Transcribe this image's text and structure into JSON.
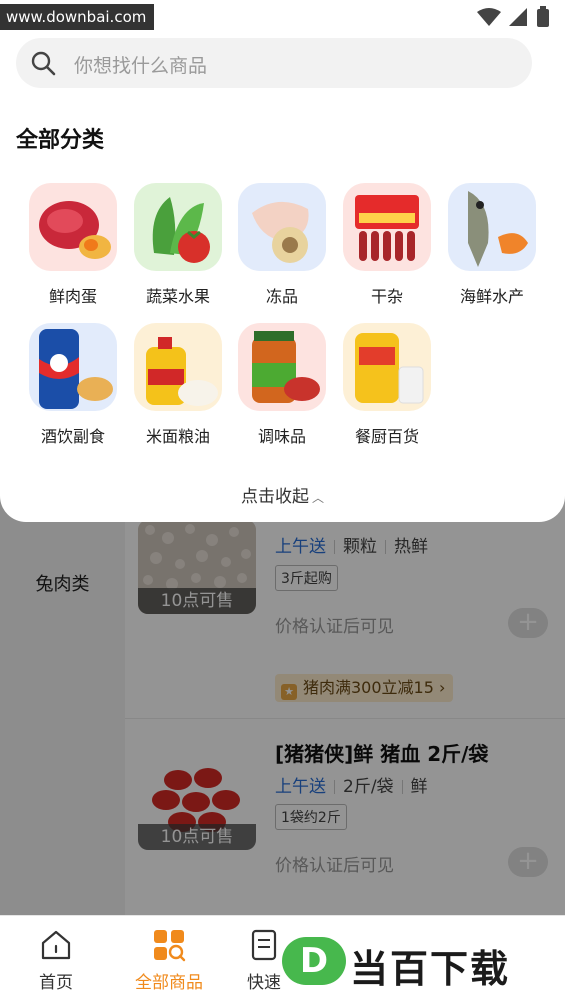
{
  "status_bar": {
    "watermark": "www.downbai.com"
  },
  "search": {
    "placeholder": "你想找什么商品"
  },
  "categories_title": "全部分类",
  "categories": [
    {
      "label": "鲜肉蛋",
      "icon": "meat-egg-icon",
      "bg": "#fde3e0"
    },
    {
      "label": "蔬菜水果",
      "icon": "vegetable-fruit-icon",
      "bg": "#e0f3d8"
    },
    {
      "label": "冻品",
      "icon": "frozen-food-icon",
      "bg": "#e2ebfb"
    },
    {
      "label": "干杂",
      "icon": "dried-goods-icon",
      "bg": "#fde3e0"
    },
    {
      "label": "海鲜水产",
      "icon": "seafood-icon",
      "bg": "#e2ebfb"
    },
    {
      "label": "酒饮副食",
      "icon": "drinks-snacks-icon",
      "bg": "#e2ebfb"
    },
    {
      "label": "米面粮油",
      "icon": "rice-oil-icon",
      "bg": "#fdf0d6"
    },
    {
      "label": "调味品",
      "icon": "seasoning-icon",
      "bg": "#fde3e0"
    },
    {
      "label": "餐厨百货",
      "icon": "kitchen-goods-icon",
      "bg": "#fdf0d6"
    }
  ],
  "collapse": {
    "label": "点击收起"
  },
  "sidebar": {
    "current": "兔肉类"
  },
  "products": [
    {
      "sale_time": "10点可售",
      "tags": [
        "上午送",
        "颗粒",
        "热鲜"
      ],
      "spec": "3斤起购",
      "price": "价格认证后可见",
      "promo": "猪肉满300立减15"
    },
    {
      "title": "[猪猪侠]鲜 猪血 2斤/袋",
      "sale_time": "10点可售",
      "tags": [
        "上午送",
        "2斤/袋",
        "鲜"
      ],
      "spec": "1袋约2斤",
      "price": "价格认证后可见"
    }
  ],
  "bottom_nav": {
    "items": [
      {
        "label": "首页",
        "icon": "home-icon"
      },
      {
        "label": "全部商品",
        "icon": "all-products-icon",
        "active": true
      },
      {
        "label": "快速",
        "icon": "quick-order-icon"
      }
    ]
  },
  "brand_overlay": {
    "badge": "D",
    "text": "当百下载"
  },
  "colors": {
    "accent": "#f08a1c",
    "tag_blue": "#2a6fd6",
    "brand_green": "#47b84d"
  }
}
